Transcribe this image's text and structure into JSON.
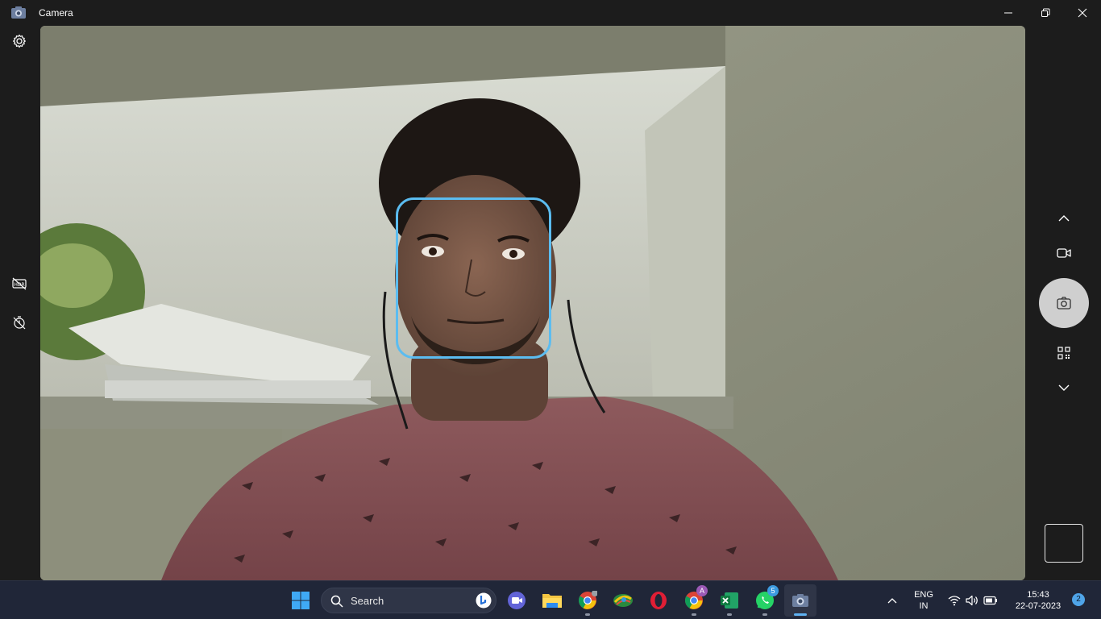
{
  "window": {
    "title": "Camera",
    "icons": {
      "app": "camera-app-icon",
      "minimize": "minimize-icon",
      "restore": "restore-icon",
      "close": "close-icon"
    }
  },
  "left_rail": [
    "settings-icon",
    "hdr-off-icon",
    "timer-off-icon"
  ],
  "right_rail": [
    "chevron-up-icon",
    "video-mode-icon",
    "photo-shutter-icon",
    "qr-scan-icon",
    "chevron-down-icon"
  ],
  "viewfinder": {
    "face_frame_color": "#5bbcf0"
  },
  "taskbar": {
    "search": {
      "label": "Search"
    },
    "pinned": [
      {
        "name": "start",
        "icon": "windows-start-icon"
      },
      {
        "name": "teams",
        "icon": "teams-meet-icon"
      },
      {
        "name": "file-explorer",
        "icon": "folder-icon"
      },
      {
        "name": "chrome",
        "icon": "chrome-icon"
      },
      {
        "name": "app-green",
        "icon": "app-icon"
      },
      {
        "name": "opera",
        "icon": "opera-icon"
      },
      {
        "name": "chrome-profile",
        "icon": "chrome-profile-icon",
        "badge": "A"
      },
      {
        "name": "excel",
        "icon": "excel-icon"
      },
      {
        "name": "whatsapp",
        "icon": "whatsapp-icon",
        "badge": "5"
      },
      {
        "name": "camera",
        "icon": "camera-icon"
      }
    ],
    "tray": {
      "language_line1": "ENG",
      "language_line2": "IN",
      "time": "15:43",
      "date": "22-07-2023",
      "notifications": "2"
    }
  },
  "colors": {
    "titlebar": "#1c1c1c",
    "taskbar": "#202638",
    "accent": "#5fb2f2"
  }
}
